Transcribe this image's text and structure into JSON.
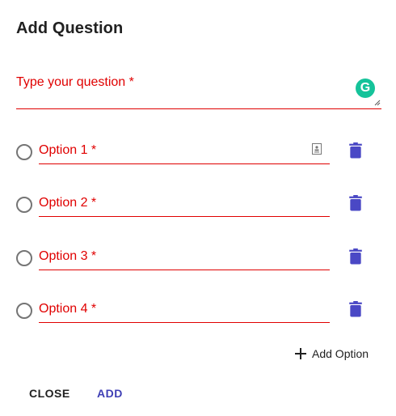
{
  "dialog": {
    "title": "Add Question",
    "question_placeholder": "Type your question *",
    "grammarly_letter": "G",
    "add_option_label": "Add Option",
    "close_label": "CLOSE",
    "add_label": "ADD"
  },
  "options": [
    {
      "label": "Option 1 *"
    },
    {
      "label": "Option 2 *"
    },
    {
      "label": "Option 3 *"
    },
    {
      "label": "Option 4 *"
    }
  ],
  "colors": {
    "error": "#e00000",
    "accent": "#3f3fb5",
    "trash": "#4a48c5",
    "grammarly": "#15c39a"
  },
  "icons": {
    "radio": "radio-unchecked-icon",
    "trash": "trash-icon",
    "plus": "plus-icon",
    "contact": "contact-card-icon",
    "grammarly": "grammarly-icon"
  }
}
